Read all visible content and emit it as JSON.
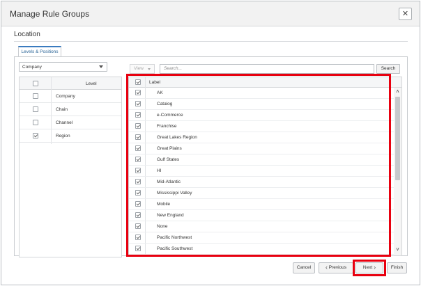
{
  "dialog": {
    "title": "Manage Rule Groups",
    "close_glyph": "✕"
  },
  "section": {
    "title": "Location",
    "tab_label": "Levels & Positions"
  },
  "hierarchy_select": {
    "value": "Company"
  },
  "level_table": {
    "header": "Level",
    "rows": [
      {
        "label": "Company",
        "checked": false
      },
      {
        "label": "Chain",
        "checked": false
      },
      {
        "label": "Channel",
        "checked": false
      },
      {
        "label": "Region",
        "checked": true
      }
    ]
  },
  "toolbar": {
    "view_label": "View",
    "search_placeholder": "Search...",
    "search_button": "Search"
  },
  "label_list": {
    "header": "Label",
    "header_checked": true,
    "rows": [
      {
        "label": "AK",
        "checked": true
      },
      {
        "label": "Catalog",
        "checked": true
      },
      {
        "label": "e-Commerce",
        "checked": true
      },
      {
        "label": "Franchise",
        "checked": true
      },
      {
        "label": "Great Lakes Region",
        "checked": true
      },
      {
        "label": "Great Plains",
        "checked": true
      },
      {
        "label": "Gulf States",
        "checked": true
      },
      {
        "label": "HI",
        "checked": true
      },
      {
        "label": "Mid-Atlantic",
        "checked": true
      },
      {
        "label": "Mississippi Valley",
        "checked": true
      },
      {
        "label": "Mobile",
        "checked": true
      },
      {
        "label": "New England",
        "checked": true
      },
      {
        "label": "None",
        "checked": true
      },
      {
        "label": "Pacific Northwest",
        "checked": true
      },
      {
        "label": "Pacific Southwest",
        "checked": true
      }
    ]
  },
  "scrollbar": {
    "up_glyph": "˄",
    "down_glyph": "˅"
  },
  "footer": {
    "cancel": "Cancel",
    "previous": "Previous",
    "next": "Next",
    "finish": "Finish",
    "prev_glyph": "‹",
    "next_glyph": "›"
  },
  "colors": {
    "highlight": "#e8000f",
    "tab_accent": "#3a7bbf"
  },
  "icons": {
    "close": "close-icon",
    "dropdown": "chevron-down-icon",
    "checkbox": "checkbox-icon"
  }
}
